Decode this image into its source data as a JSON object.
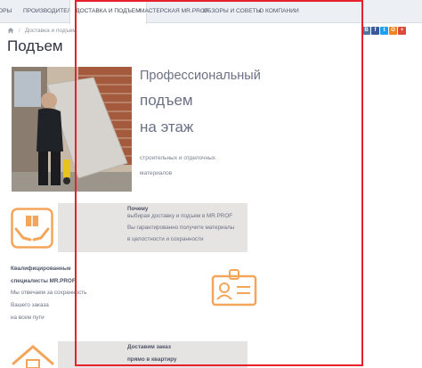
{
  "nav": {
    "items": [
      {
        "label": "ОРЫ"
      },
      {
        "label": "ПРОИЗВОДИТЕЛИ"
      },
      {
        "label": "ДОСТАВКА И ПОДЪЕМ"
      },
      {
        "label": "МАСТЕРСКАЯ MR.PROF"
      },
      {
        "label": "ОБЗОРЫ И СОВЕТЫ"
      },
      {
        "label": "О КОМПАНИИ"
      }
    ],
    "active_index": 2
  },
  "breadcrumb": {
    "home_icon": "home-icon",
    "separator": "/",
    "current": "Доставка и подъем"
  },
  "share": [
    {
      "letter": "В",
      "color": "#4a76a8"
    },
    {
      "letter": "f",
      "color": "#3b5998"
    },
    {
      "letter": "t",
      "color": "#1da1f2"
    },
    {
      "letter": "О",
      "color": "#f58220"
    },
    {
      "letter": "+",
      "color": "#dd4b39"
    }
  ],
  "page": {
    "title": "Подъем"
  },
  "hero": {
    "line1": "Профессиональный",
    "line2": "подъем",
    "line3": "на этаж",
    "sub1": "строительных и отделочных",
    "sub2": "материалов"
  },
  "features": {
    "f1": {
      "icon": "package-hands-icon",
      "title": "Почему",
      "line1": "выбирая доставку и подъем в MR.PROF",
      "line2": "Вы гарантированно получите материалы",
      "line3": "в целостности и сохранности"
    },
    "f2": {
      "icon": "id-badge-icon",
      "title1": "Квалифицированные",
      "title2": "специалисты MR.PROF",
      "line1": "Мы отвечаем за сохранность",
      "line2": "Вашего заказа",
      "line3": "на всем пути"
    },
    "f3": {
      "icon": "house-icon",
      "title1": "Доставим заказ",
      "title2": "прямо в квартиру"
    }
  },
  "colors": {
    "accent_orange": "#f3a55a",
    "panel_gray": "#e6e3e3",
    "selection_red": "#e8202b"
  }
}
